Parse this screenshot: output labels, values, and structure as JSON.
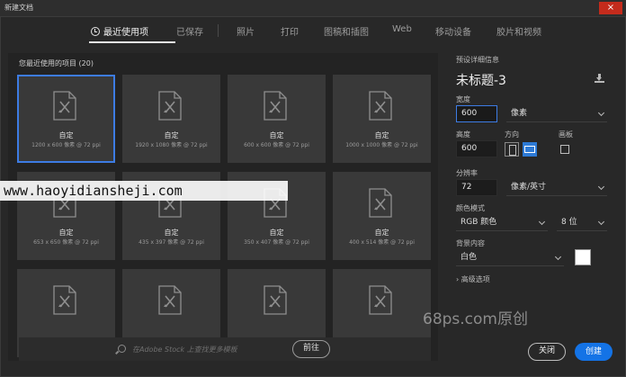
{
  "window": {
    "title": "新建文档",
    "close_glyph": "×"
  },
  "tabs": [
    {
      "label": "最近使用项",
      "active": true
    },
    {
      "label": "已保存"
    },
    {
      "label": "照片"
    },
    {
      "label": "打印"
    },
    {
      "label": "图稿和插图"
    },
    {
      "label": "Web"
    },
    {
      "label": "移动设备"
    },
    {
      "label": "胶片和视频"
    }
  ],
  "recent": {
    "title": "您最近使用的项目",
    "count": "(20)",
    "items": [
      {
        "name": "自定",
        "size": "1200 x 600 像素 @ 72 ppi",
        "selected": true
      },
      {
        "name": "自定",
        "size": "1920 x 1080 像素 @ 72 ppi"
      },
      {
        "name": "自定",
        "size": "600 x 600 像素 @ 72 ppi"
      },
      {
        "name": "自定",
        "size": "1000 x 1000 像素 @ 72 ppi"
      },
      {
        "name": "自定",
        "size": "653 x 650 像素 @ 72 ppi"
      },
      {
        "name": "自定",
        "size": "435 x 397 像素 @ 72 ppi"
      },
      {
        "name": "自定",
        "size": "350 x 407 像素 @ 72 ppi"
      },
      {
        "name": "自定",
        "size": "400 x 514 像素 @ 72 ppi"
      },
      {
        "name": "",
        "size": ""
      },
      {
        "name": "",
        "size": ""
      },
      {
        "name": "",
        "size": ""
      },
      {
        "name": "",
        "size": ""
      }
    ]
  },
  "search": {
    "placeholder": "在Adobe Stock 上查找更多模板",
    "go_label": "前往"
  },
  "preset": {
    "section_label": "预设详细信息",
    "doc_name": "未标题-3",
    "width_label": "宽度",
    "width_value": "600",
    "width_unit": "像素",
    "height_label": "高度",
    "height_value": "600",
    "orientation_label": "方向",
    "artboard_label": "画板",
    "resolution_label": "分辨率",
    "resolution_value": "72",
    "resolution_unit": "像素/英寸",
    "color_mode_label": "颜色模式",
    "color_mode_value": "RGB 颜色",
    "bit_depth_value": "8 位",
    "background_label": "背景内容",
    "background_value": "白色",
    "advanced_label": "高级选项"
  },
  "actions": {
    "close_label": "关闭",
    "create_label": "创建"
  },
  "watermarks": {
    "site": "www.haoyidiansheji.com",
    "tag": "68ps.com原创"
  },
  "colors": {
    "accent": "#1473e6",
    "selection": "#3d7ce4"
  }
}
